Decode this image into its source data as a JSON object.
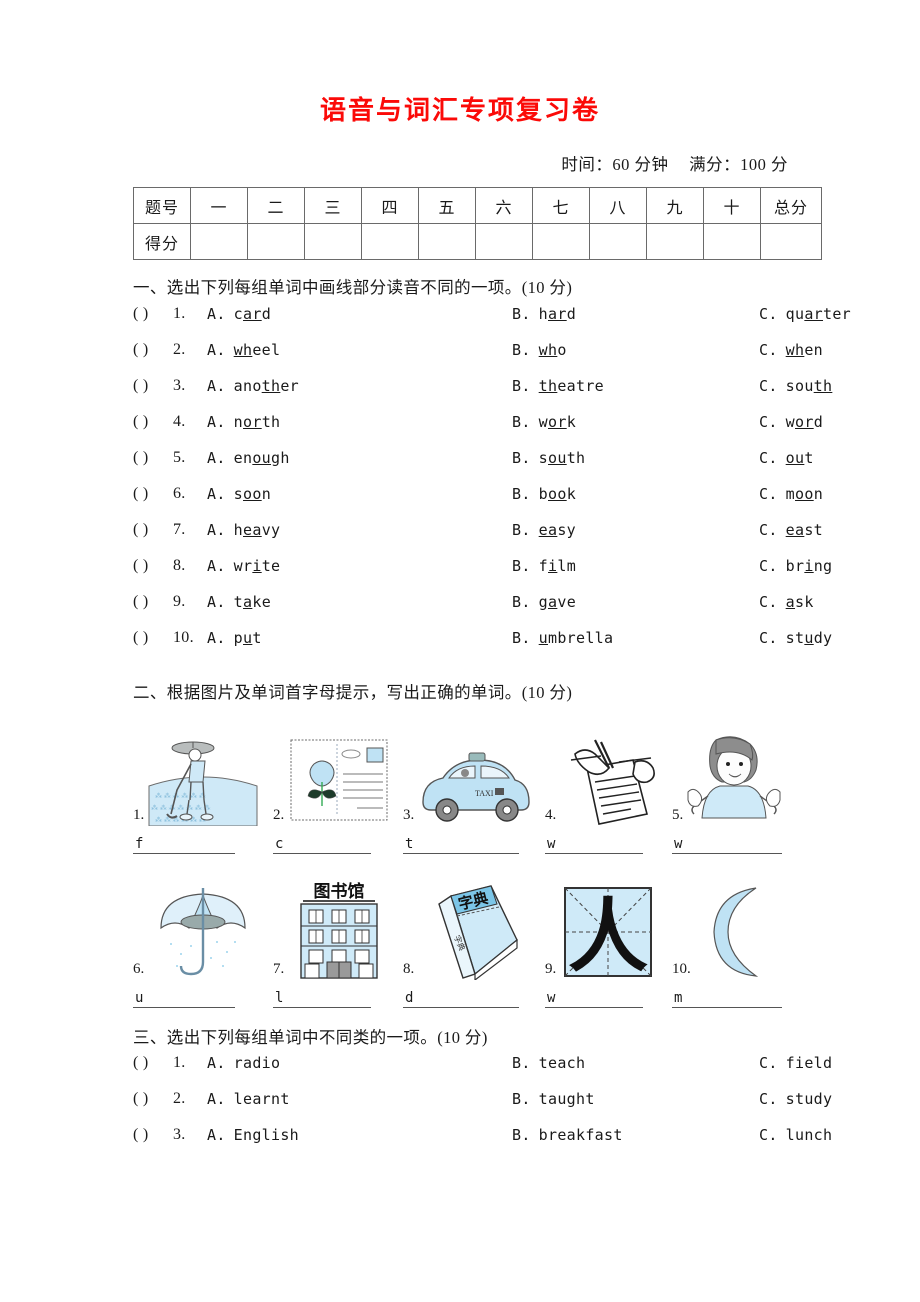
{
  "title": "语音与词汇专项复习卷",
  "meta": {
    "time": "时间：60 分钟",
    "total": "满分：100 分"
  },
  "score_table": {
    "row_header_1": "题号",
    "row_header_2": "得分",
    "columns": [
      "一",
      "二",
      "三",
      "四",
      "五",
      "六",
      "七",
      "八",
      "九",
      "十",
      "总分"
    ]
  },
  "sections": [
    {
      "heading": "一、选出下列每组单词中画线部分读音不同的一项。(10 分)",
      "paren": "(    )",
      "questions": [
        {
          "n": "1.",
          "a_pre": "c",
          "a_ul": "ar",
          "a_post": "d",
          "b_pre": "h",
          "b_ul": "ar",
          "b_post": "d",
          "c_pre": "qu",
          "c_ul": "ar",
          "c_post": "ter"
        },
        {
          "n": "2.",
          "a_pre": "",
          "a_ul": "wh",
          "a_post": "eel",
          "b_pre": "",
          "b_ul": "wh",
          "b_post": "o",
          "c_pre": "",
          "c_ul": "wh",
          "c_post": "en"
        },
        {
          "n": "3.",
          "a_pre": "ano",
          "a_ul": "th",
          "a_post": "er",
          "b_pre": "",
          "b_ul": "th",
          "b_post": "eatre",
          "c_pre": "sou",
          "c_ul": "th",
          "c_post": ""
        },
        {
          "n": "4.",
          "a_pre": "n",
          "a_ul": "or",
          "a_post": "th",
          "b_pre": "w",
          "b_ul": "or",
          "b_post": "k",
          "c_pre": "w",
          "c_ul": "or",
          "c_post": "d"
        },
        {
          "n": "5.",
          "a_pre": "en",
          "a_ul": "ou",
          "a_post": "gh",
          "b_pre": "s",
          "b_ul": "ou",
          "b_post": "th",
          "c_pre": "",
          "c_ul": "ou",
          "c_post": "t"
        },
        {
          "n": "6.",
          "a_pre": "s",
          "a_ul": "oo",
          "a_post": "n",
          "b_pre": "b",
          "b_ul": "oo",
          "b_post": "k",
          "c_pre": "m",
          "c_ul": "oo",
          "c_post": "n"
        },
        {
          "n": "7.",
          "a_pre": "h",
          "a_ul": "ea",
          "a_post": "vy",
          "b_pre": "",
          "b_ul": "ea",
          "b_post": "sy",
          "c_pre": "",
          "c_ul": "ea",
          "c_post": "st"
        },
        {
          "n": "8.",
          "a_pre": "wr",
          "a_ul": "i",
          "a_post": "te",
          "b_pre": "f",
          "b_ul": "i",
          "b_post": "lm",
          "c_pre": "br",
          "c_ul": "i",
          "c_post": "ng"
        },
        {
          "n": "9.",
          "a_pre": "t",
          "a_ul": "a",
          "a_post": "ke",
          "b_pre": "g",
          "b_ul": "a",
          "b_post": "ve",
          "c_pre": "",
          "c_ul": "a",
          "c_post": "sk"
        },
        {
          "n": "10.",
          "a_pre": "p",
          "a_ul": "u",
          "a_post": "t",
          "b_pre": "",
          "b_ul": "u",
          "b_post": "mbrella",
          "c_pre": "st",
          "c_ul": "u",
          "c_post": "dy"
        }
      ]
    }
  ],
  "section_two": {
    "heading": "二、根据图片及单词首字母提示，写出正确的单词。(10 分)",
    "row_one": [
      {
        "num": "1.",
        "icon": "farmer-in-field-icon",
        "blank_letter": "f"
      },
      {
        "num": "2.",
        "icon": "postcard-with-flower-icon",
        "blank_letter": "c"
      },
      {
        "num": "3.",
        "icon": "taxi-icon",
        "blank_letter": "t",
        "taxi_label": "TAXI"
      },
      {
        "num": "4.",
        "icon": "hand-writing-icon",
        "blank_letter": "w"
      },
      {
        "num": "5.",
        "icon": "person-welcoming-icon",
        "blank_letter": "w"
      }
    ],
    "row_two": [
      {
        "num": "6.",
        "icon": "umbrella-icon",
        "blank_letter": "u"
      },
      {
        "num": "7.",
        "icon": "library-building-icon",
        "blank_letter": "l",
        "sign": "图书馆"
      },
      {
        "num": "8.",
        "icon": "dictionary-book-icon",
        "blank_letter": "d",
        "cover": "字典"
      },
      {
        "num": "9.",
        "icon": "chinese-character-grid-icon",
        "blank_letter": "w",
        "character": "人"
      },
      {
        "num": "10.",
        "icon": "crescent-moon-icon",
        "blank_letter": "m"
      }
    ]
  },
  "section_three": {
    "heading": "三、选出下列每组单词中不同类的一项。(10 分)",
    "paren": "(    )",
    "questions": [
      {
        "n": "1.",
        "a": "radio",
        "b": "teach",
        "c": "field"
      },
      {
        "n": "2.",
        "a": "learnt",
        "b": "taught",
        "c": "study"
      },
      {
        "n": "3.",
        "a": "English",
        "b": "breakfast",
        "c": "lunch"
      }
    ]
  },
  "labels": {
    "optA": "A.",
    "optB": "B.",
    "optC": "C."
  },
  "colors": {
    "title_red": "#fb0a08",
    "art_blue": "#aedcf0",
    "art_line": "#4a4a4a"
  }
}
